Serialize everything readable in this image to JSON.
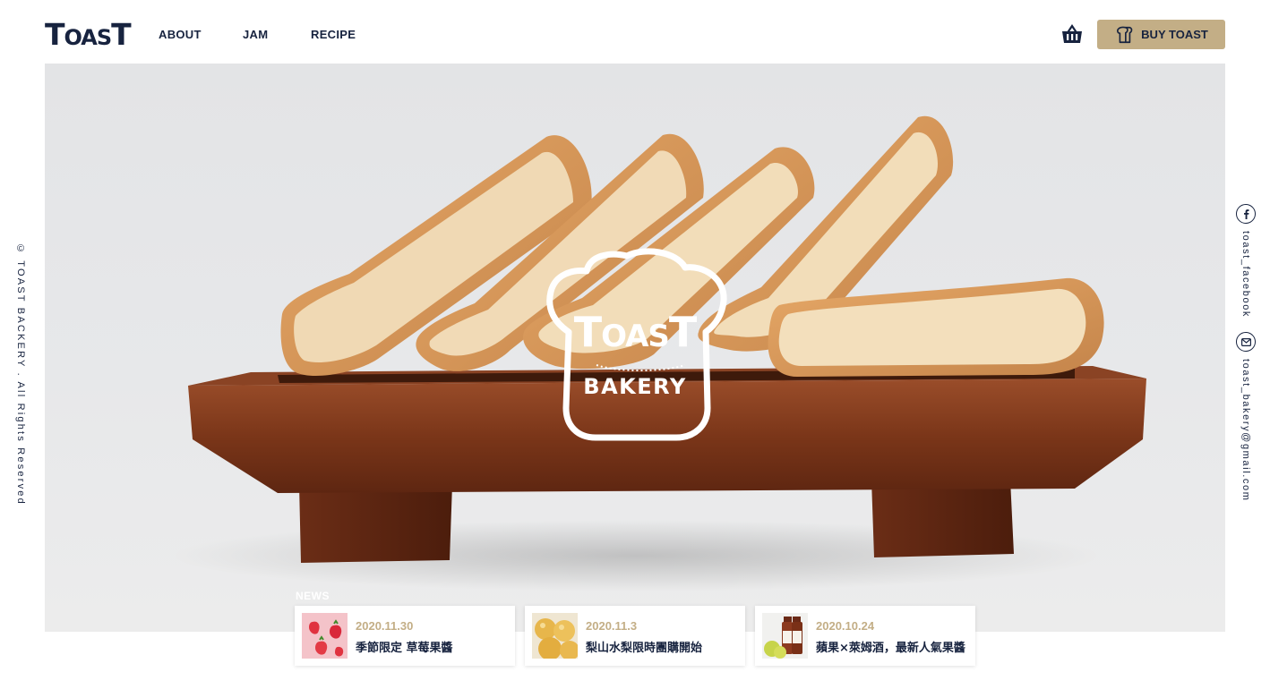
{
  "header": {
    "logo_big1": "T",
    "logo_small": "OAS",
    "logo_big2": "T",
    "nav": [
      {
        "label": "ABOUT"
      },
      {
        "label": "JAM"
      },
      {
        "label": "RECIPE"
      }
    ],
    "cart_icon": "basket-icon",
    "buy_button": {
      "label": "BUY TOAST",
      "icon": "toast-bread-icon"
    }
  },
  "hero": {
    "logo_big1": "T",
    "logo_small": "OAS",
    "logo_big2": "T",
    "logo_subtitle": "BAKERY"
  },
  "sidebar": {
    "copyright": "© TOAST BACKERY . All Rights Reserved",
    "social": [
      {
        "icon": "facebook-icon",
        "label": "toast_facebook"
      },
      {
        "icon": "mail-icon",
        "label": "toast_bakery@gmail.com"
      }
    ]
  },
  "news": {
    "label": "NEWS",
    "items": [
      {
        "date": "2020.11.30",
        "title": "季節限定 草莓果醬",
        "thumb": "strawberries"
      },
      {
        "date": "2020.11.3",
        "title": "梨山水梨限時團購開始",
        "thumb": "pears"
      },
      {
        "date": "2020.10.24",
        "title": "蘋果×萊姆酒，最新人氣果醬",
        "thumb": "apple-rum-bottles"
      }
    ]
  },
  "colors": {
    "navy": "#17233f",
    "gold": "#c3ae86",
    "hero_bg": "#e5e6e8"
  }
}
